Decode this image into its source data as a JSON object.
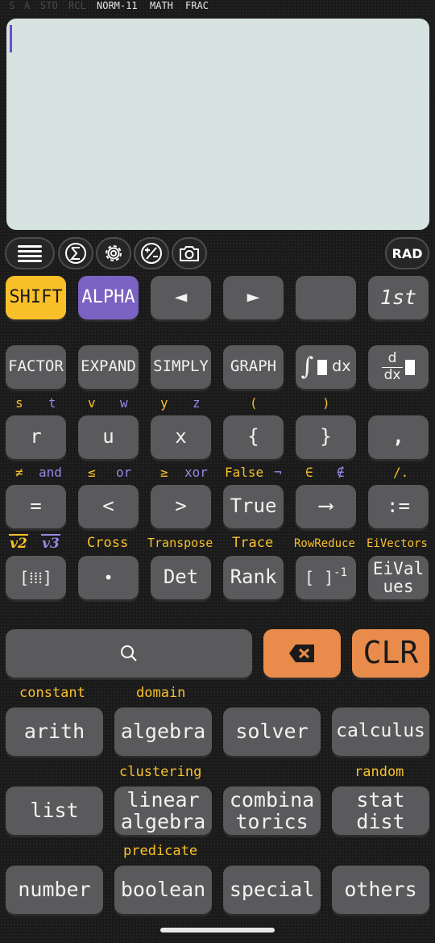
{
  "status_bar": {
    "indicators_inactive": [
      "S",
      "A",
      "STO",
      "RCL"
    ],
    "indicators_active": [
      "NORM-11",
      "MATH",
      "FRAC"
    ]
  },
  "display": {
    "expression": ""
  },
  "toolbar": {
    "menu_icon": "menu-icon",
    "sum_icon": "sigma-icon",
    "settings_icon": "gear-icon",
    "plusminus_icon": "plus-minus-icon",
    "camera_icon": "camera-icon",
    "angle_mode": "RAD"
  },
  "keys_row1": {
    "shift": "SHIFT",
    "alpha": "ALPHA",
    "left": "◄",
    "right": "►",
    "blank": "",
    "mode": "1st"
  },
  "keys_row2": {
    "factor": "FACTOR",
    "expand": "EXPAND",
    "simply": "SIMPLY",
    "graph": "GRAPH",
    "integral": "∫",
    "integral_suffix": "dx",
    "derivative_top": "d",
    "derivative_bottom": "dx"
  },
  "labels_row3": [
    "s",
    "t",
    "v",
    "w",
    "y",
    "z",
    "(",
    ")"
  ],
  "keys_row3": [
    "r",
    "u",
    "x",
    "{",
    "}",
    ","
  ],
  "labels_row4": [
    "≠",
    "and",
    "≤",
    "or",
    "≥",
    "xor",
    "False",
    "¬",
    "∈",
    "∉",
    "/."
  ],
  "keys_row4": [
    "=",
    "<",
    ">",
    "True",
    "⟶",
    ":="
  ],
  "labels_row5": {
    "v2": "v2",
    "v3": "v3",
    "cross": "Cross",
    "transpose": "Transpose",
    "trace": "Trace",
    "rowreduce": "RowReduce",
    "eivectors": "EiVectors"
  },
  "keys_row5": {
    "matrix": "[⁞⁞⁞]",
    "dot": "•",
    "det": "Det",
    "rank": "Rank",
    "inverse": "[ ]",
    "inverse_sup": "-1",
    "eivalues_1": "EiVal",
    "eivalues_2": "ues"
  },
  "input_row": {
    "search_icon": "search-icon",
    "backspace_icon": "backspace-icon",
    "clear": "CLR"
  },
  "categories": {
    "label_constant": "constant",
    "label_domain": "domain",
    "arith": "arith",
    "algebra": "algebra",
    "solver": "solver",
    "calculus": "calculus",
    "label_clustering": "clustering",
    "label_random": "random",
    "list": "list",
    "linear_1": "linear",
    "linear_2": "algebra",
    "combina_1": "combina",
    "combina_2": "torics",
    "stat_1": "stat",
    "stat_2": "dist",
    "label_predicate": "predicate",
    "number": "number",
    "boolean": "boolean",
    "special": "special",
    "others": "others"
  },
  "colors": {
    "shift": "#f9c02a",
    "alpha": "#7a62c2",
    "key": "#5a5a5c",
    "display": "#d6e3e1",
    "orange": "#e98b4a",
    "label_yellow": "#f9c02a",
    "label_purple": "#9a86e6"
  }
}
